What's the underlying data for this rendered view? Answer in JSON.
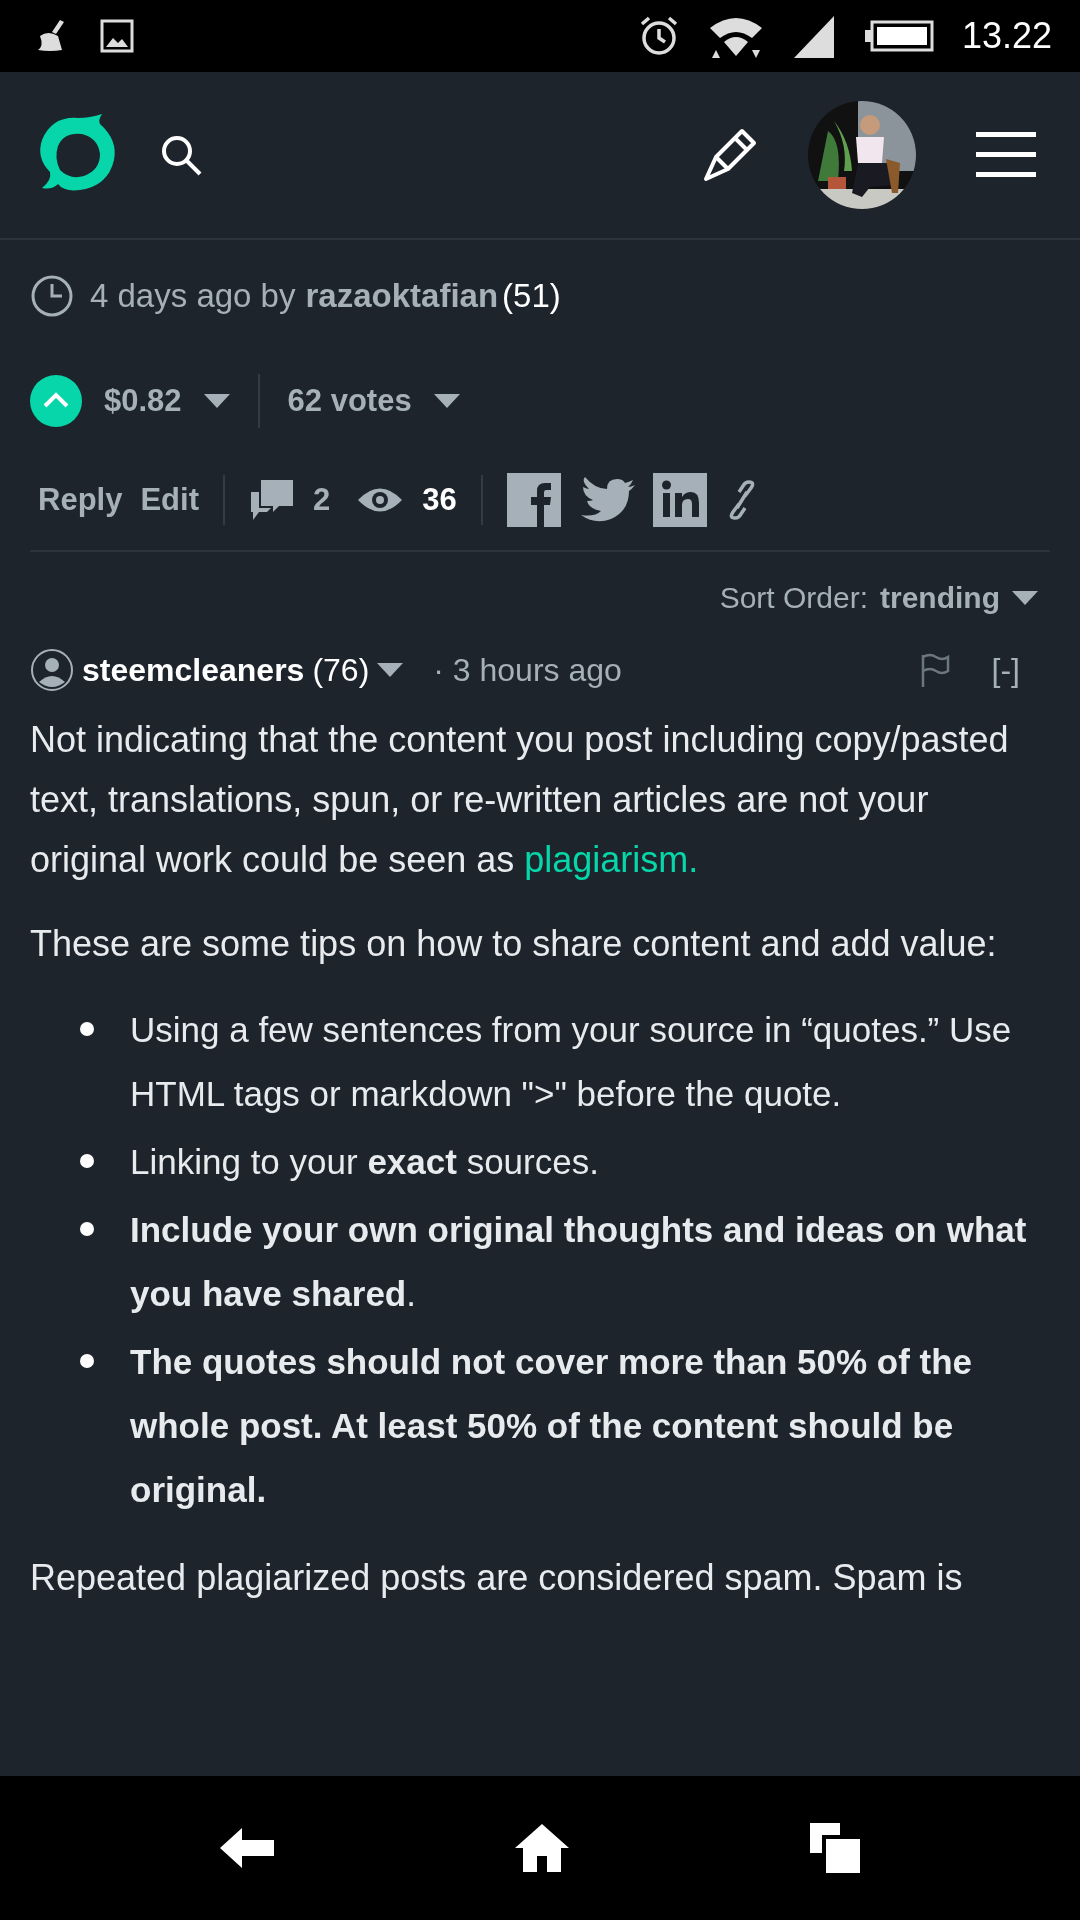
{
  "status_bar": {
    "time": "13.22"
  },
  "post_meta": {
    "posted": "4 days ago by",
    "author": "razaoktafian",
    "reputation": "(51)"
  },
  "voting": {
    "upvoted": true,
    "payout": "$0.82",
    "votes": "62 votes"
  },
  "actions": {
    "reply": "Reply",
    "edit": "Edit",
    "comments": "2",
    "views": "36"
  },
  "sort": {
    "label": "Sort Order:",
    "value": "trending"
  },
  "comment": {
    "author": "steemcleaners",
    "reputation": "(76)",
    "time": "· 3 hours ago",
    "collapse": "[-]",
    "intro": {
      "text": "Not indicating that the content you post including copy/pasted text, translations, spun, or re-written articles are not your original work could be seen as",
      "link": "plagiarism."
    },
    "lead": "These are some tips on how to share content and add value:",
    "tips": [
      {
        "text": "Using a few sentences from your source in “quotes.” Use HTML tags or markdown \">\" before the quote.",
        "bold": false
      },
      {
        "text": "Linking to your **exact** sources.",
        "bold": false
      },
      {
        "text": "**Include your own original thoughts and ideas on what you have shared**.",
        "bold": false
      },
      {
        "text": "The quotes should not cover more than 50% of the whole post. At least 50% of the content should be original.",
        "bold": true
      }
    ],
    "closing": "Repeated plagiarized posts are considered spam. Spam is"
  }
}
